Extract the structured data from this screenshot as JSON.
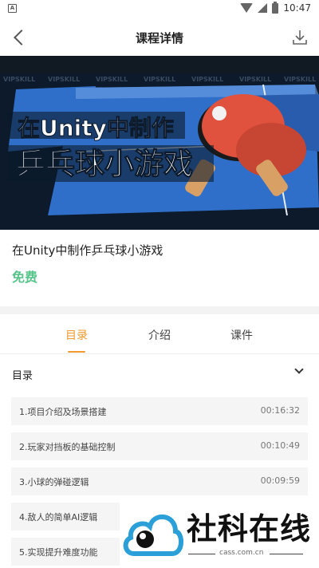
{
  "status_bar": {
    "app_icon": "A",
    "time": "10:47"
  },
  "header": {
    "title": "课程详情",
    "back_icon": "back-arrow-icon",
    "download_icon": "download-icon"
  },
  "banner": {
    "watermark_text": "VIPSKILL",
    "headline_line1": "在Unity中制作",
    "headline_line2": "乒乓球小游戏",
    "colors": {
      "background": "#0c1a2c",
      "table": "#2f6fc9",
      "paddle": "#e0523d",
      "headline": "#ffffff"
    }
  },
  "course": {
    "title": "在Unity中制作乒乓球小游戏",
    "price": "免费",
    "price_color": "#57c58a"
  },
  "tabs": [
    {
      "label": "目录",
      "active": true
    },
    {
      "label": "介绍",
      "active": false
    },
    {
      "label": "课件",
      "active": false
    }
  ],
  "accent_color": "#f29a2e",
  "catalog": {
    "label": "目录",
    "lessons": [
      {
        "title": "1.项目介绍及场景搭建",
        "duration": "00:16:32"
      },
      {
        "title": "2.玩家对挡板的基础控制",
        "duration": "00:10:49"
      },
      {
        "title": "3.小球的弹碰逻辑",
        "duration": "00:09:59"
      },
      {
        "title": "4.敌人的简单AI逻辑",
        "duration": ""
      },
      {
        "title": "5.实现提升难度功能",
        "duration": ""
      }
    ]
  },
  "site_watermark": {
    "name": "社科在线",
    "url": "cass.com.cn"
  }
}
